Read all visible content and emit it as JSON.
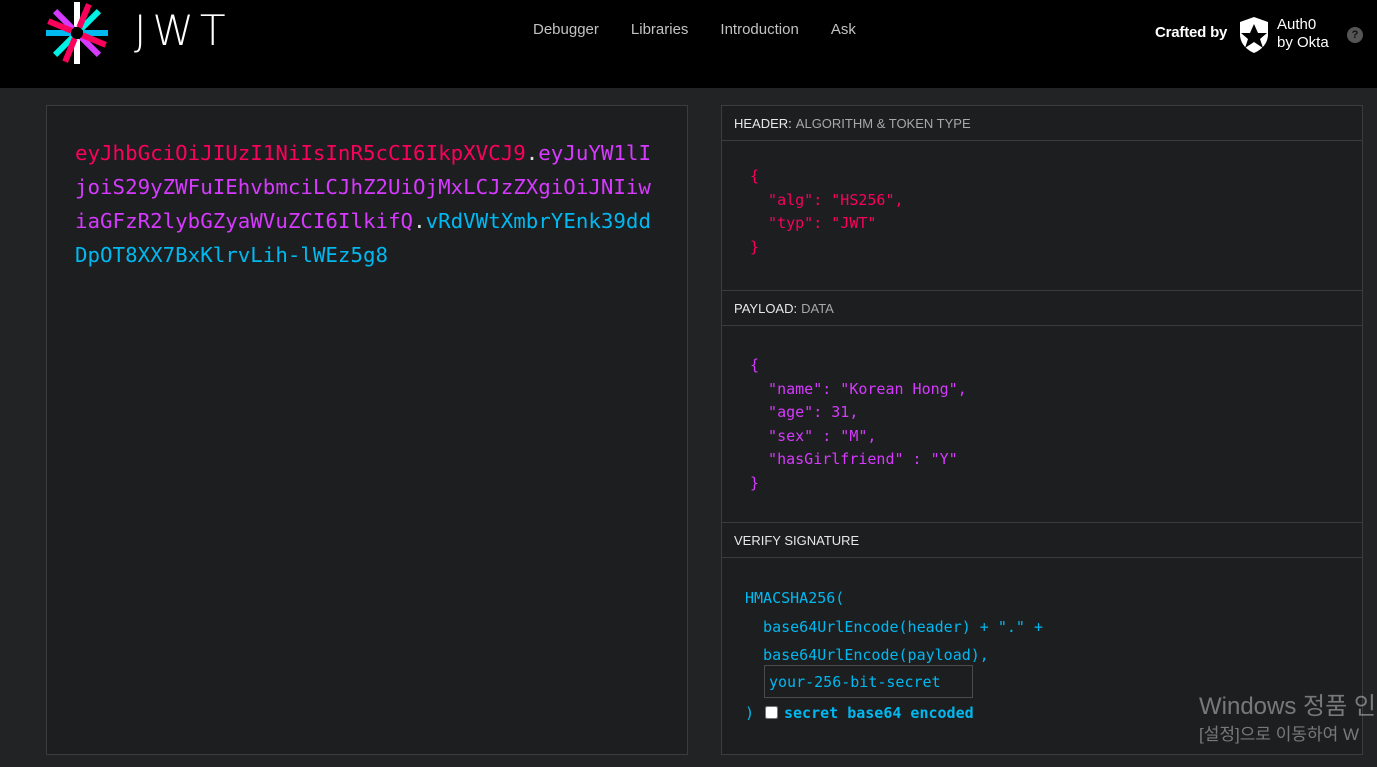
{
  "brand": {
    "wordmark": "JWT",
    "logo_icon": "jwt-starburst-logo"
  },
  "nav": [
    {
      "label": "Debugger"
    },
    {
      "label": "Libraries"
    },
    {
      "label": "Introduction"
    },
    {
      "label": "Ask"
    }
  ],
  "credits": {
    "crafted_by": "Crafted by",
    "company_line1": "Auth0",
    "company_line2": "by Okta",
    "shield_icon": "auth0-shield-icon",
    "help_label": "?"
  },
  "encoded": {
    "header": "eyJhbGciOiJIUzI1NiIsInR5cCI6IkpXVCJ9",
    "dot1": ".",
    "payload": "eyJuYW1lIjoiS29yZWFuIEhvbmciLCJhZ2UiOjMxLCJzZXgiOiJNIiwiaGFzR2lybGZyaWVuZCI6IlkifQ",
    "dot2": ".",
    "signature": "vRdVWtXmbrYEnk39ddDpOT8XX7BxKlrvLih-lWEz5g8"
  },
  "decoded": {
    "header": {
      "title": "HEADER:",
      "subtitle": "ALGORITHM & TOKEN TYPE",
      "code": "{\n  \"alg\": \"HS256\",\n  \"typ\": \"JWT\"\n}"
    },
    "payload": {
      "title": "PAYLOAD:",
      "subtitle": "DATA",
      "code": "{\n  \"name\": \"Korean Hong\",\n  \"age\": 31,\n  \"sex\" : \"M\",\n  \"hasGirlfriend\" : \"Y\"\n}"
    },
    "signature": {
      "title": "VERIFY SIGNATURE",
      "code": "HMACSHA256(\n  base64UrlEncode(header) + \".\" +\n  base64UrlEncode(payload),",
      "secret_placeholder": "your-256-bit-secret",
      "close_paren": ")",
      "base64_label": "secret base64 encoded"
    }
  },
  "colors": {
    "header": "#fb015b",
    "payload": "#d63aff",
    "signature": "#00b9f1"
  },
  "watermark": {
    "line1": "Windows 정품 인",
    "line2": "[설정]으로 이동하여 W"
  }
}
